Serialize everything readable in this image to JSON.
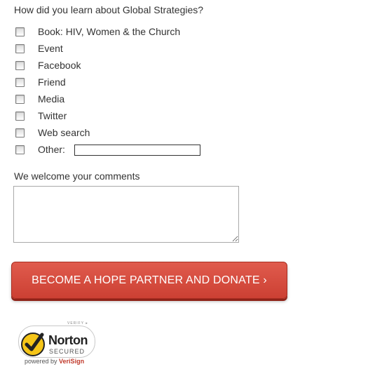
{
  "form": {
    "question": "How did you learn about Global Strategies?",
    "options": [
      {
        "label": "Book: HIV, Women & the Church",
        "checked": false
      },
      {
        "label": "Event",
        "checked": false
      },
      {
        "label": "Facebook",
        "checked": false
      },
      {
        "label": "Friend",
        "checked": false
      },
      {
        "label": "Media",
        "checked": false
      },
      {
        "label": "Twitter",
        "checked": false
      },
      {
        "label": "Web search",
        "checked": false
      },
      {
        "label": "Other:",
        "checked": false
      }
    ],
    "other_value": "",
    "comments_label": "We welcome your comments",
    "comments_value": "",
    "donate_label": "BECOME A HOPE PARTNER AND DONATE ›",
    "donate_color": "#d44a3d"
  },
  "seal": {
    "verify": "VERIFY ▸",
    "name": "Norton",
    "secured": "SECURED",
    "powered_by": "powered by",
    "verisign": "VeriSign",
    "check_color": "#f5c518"
  }
}
